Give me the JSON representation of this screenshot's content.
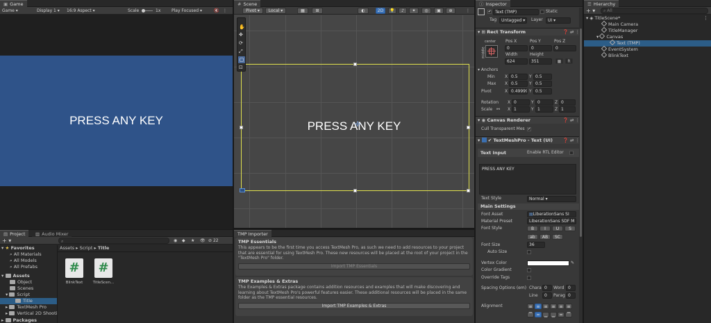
{
  "game": {
    "tab": "Game",
    "mode": "Game",
    "display": "Display 1",
    "aspect": "16:9 Aspect",
    "scale_label": "Scale",
    "scale_value": "1x",
    "play_mode": "Play Focused",
    "text": "PRESS ANY KEY",
    "bg_color": "#2f5389"
  },
  "scene": {
    "tab": "Scene",
    "pivot": "Pivot",
    "local": "Local",
    "mode_2d": "2D",
    "text": "PRESS ANY KEY"
  },
  "project": {
    "tab_project": "Project",
    "tab_audio": "Audio Mixer",
    "hidden_count": "22",
    "breadcrumb": [
      "Assets",
      "Script",
      "Title"
    ],
    "favorites_label": "Favorites",
    "favorites": [
      "All Materials",
      "All Models",
      "All Prefabs"
    ],
    "assets_label": "Assets",
    "asset_tree": [
      "Object",
      "Scenes",
      "Script",
      "Title",
      "TextMesh Pro",
      "Vertical 2D Shootin"
    ],
    "packages_label": "Packages",
    "files": [
      {
        "name": "BlinkText",
        "glyph": "#"
      },
      {
        "name": "TitleScen...",
        "glyph": "#"
      }
    ]
  },
  "tmp_importer": {
    "tab": "TMP Importer",
    "essentials_title": "TMP Essentials",
    "essentials_body": "This appears to be the first time you access TextMesh Pro, as such we need to add resources to your project that are essential for using TextMesh Pro. These new resources will be placed at the root of your project in the \"TextMesh Pro\" folder.",
    "essentials_button": "Import TMP Essentials",
    "extras_title": "TMP Examples & Extras",
    "extras_body": "The Examples & Extras package contains addition resources and examples that will make discovering and learning about TextMesh Pro's powerful features easier. These additional resources will be placed in the same folder as the TMP essential resources.",
    "extras_button": "Import TMP Examples & Extras"
  },
  "inspector": {
    "tab": "Inspector",
    "object_name": "Text (TMP)",
    "static_label": "Static",
    "tag_label": "Tag",
    "tag_value": "Untagged",
    "layer_label": "Layer",
    "layer_value": "UI",
    "rect_transform": {
      "title": "Rect Transform",
      "anchor_preset": "center",
      "side_label": "middle",
      "pos_x_label": "Pos X",
      "pos_y_label": "Pos Y",
      "pos_z_label": "Pos Z",
      "pos_x": "0",
      "pos_y": "0",
      "pos_z": "0",
      "width_label": "Width",
      "height_label": "Height",
      "width": "624",
      "height": "351",
      "anchors_label": "Anchors",
      "min_label": "Min",
      "max_label": "Max",
      "min_x": "0.5",
      "min_y": "0.5",
      "max_x": "0.5",
      "max_y": "0.5",
      "pivot_label": "Pivot",
      "pivot_x": "0.49999",
      "pivot_y": "0.5",
      "rotation_label": "Rotation",
      "rot_x": "0",
      "rot_y": "0",
      "rot_z": "0",
      "scale_label": "Scale",
      "scale_x": "1",
      "scale_y": "1",
      "scale_z": "1",
      "x": "X",
      "y": "Y",
      "z": "Z",
      "r_button": "R"
    },
    "canvas_renderer": {
      "title": "Canvas Renderer",
      "cull_label": "Cull Transparent Mes"
    },
    "tmp": {
      "title": "TextMeshPro - Text (UI)",
      "text_input_label": "Text Input",
      "rtl_label": "Enable RTL Editor",
      "text_value": "PRESS ANY KEY",
      "text_style_label": "Text Style",
      "text_style_value": "Normal",
      "main_settings": "Main Settings",
      "font_asset_label": "Font Asset",
      "font_asset_value": "LiberationSans SI",
      "material_label": "Material Preset",
      "material_value": "LiberationSans SDF M",
      "font_style_label": "Font Style",
      "font_style_buttons": [
        "B",
        "I",
        "U",
        "S"
      ],
      "font_case_buttons": [
        "ab",
        "AB",
        "SC"
      ],
      "font_size_label": "Font Size",
      "font_size_value": "36",
      "auto_size_label": "Auto Size",
      "vertex_color_label": "Vertex Color",
      "color_gradient_label": "Color Gradient",
      "override_tags_label": "Override Tags",
      "spacing_label": "Spacing Options (em)",
      "char_label": "Chara",
      "char_value": "0",
      "word_label": "Word",
      "word_value": "0",
      "line_label": "Line",
      "line_value": "0",
      "para_label": "Parag",
      "para_value": "0",
      "alignment_label": "Alignment"
    }
  },
  "hierarchy": {
    "tab": "Hierarchy",
    "search_placeholder": "All",
    "scene_name": "TitleScene*",
    "items": [
      {
        "label": "Main Camera",
        "depth": 1,
        "selected": false
      },
      {
        "label": "TitleManager",
        "depth": 1,
        "selected": false
      },
      {
        "label": "Canvas",
        "depth": 1,
        "selected": false
      },
      {
        "label": "Text (TMP)",
        "depth": 2,
        "selected": true
      },
      {
        "label": "EventSystem",
        "depth": 1,
        "selected": false
      },
      {
        "label": "BlinkText",
        "depth": 1,
        "selected": false
      }
    ]
  }
}
